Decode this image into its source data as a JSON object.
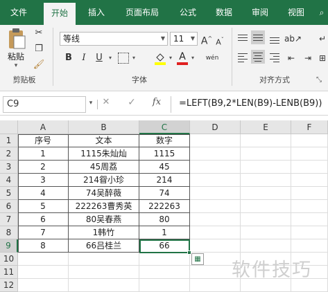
{
  "tabs": [
    "文件",
    "开始",
    "插入",
    "页面布局",
    "公式",
    "数据",
    "审阅",
    "视图"
  ],
  "ribbon": {
    "paste_label": "粘贴",
    "clipboard_group": "剪贴板",
    "font_name": "等线",
    "font_size": "11",
    "font_group": "字体",
    "align_group": "对齐方式",
    "bold": "B",
    "italic": "I",
    "underline": "U",
    "grow_font": "A",
    "shrink_font": "A",
    "font_color_glyph": "A",
    "phonetic_glyph": "wén"
  },
  "formula_bar": {
    "name_box": "C9",
    "cancel": "✕",
    "enter": "✓",
    "fx": "fx",
    "formula": "=LEFT(B9,2*LEN(B9)-LENB(B9))"
  },
  "sheet": {
    "columns": [
      "A",
      "B",
      "C",
      "D",
      "E",
      "F"
    ],
    "rows": [
      "1",
      "2",
      "3",
      "4",
      "5",
      "6",
      "7",
      "8",
      "9",
      "10",
      "11",
      "12"
    ],
    "table": [
      [
        "序号",
        "文本",
        "数字"
      ],
      [
        "1",
        "1115朱灿灿",
        "1115"
      ],
      [
        "2",
        "45周荔",
        "45"
      ],
      [
        "3",
        "214眢小珍",
        "214"
      ],
      [
        "4",
        "74吴醉薇",
        "74"
      ],
      [
        "5",
        "222263曹秀英",
        "222263"
      ],
      [
        "6",
        "80吴春燕",
        "80"
      ],
      [
        "7",
        "1韩竹",
        "1"
      ],
      [
        "8",
        "66吕桂兰",
        "66"
      ]
    ],
    "selected_cell": "C9"
  },
  "watermark": "软件技巧",
  "colors": {
    "brand": "#217346",
    "ribbon_bg": "#f3f3f3",
    "font_color_bar": "#e02020",
    "highlight_bar": "#ffff00"
  }
}
